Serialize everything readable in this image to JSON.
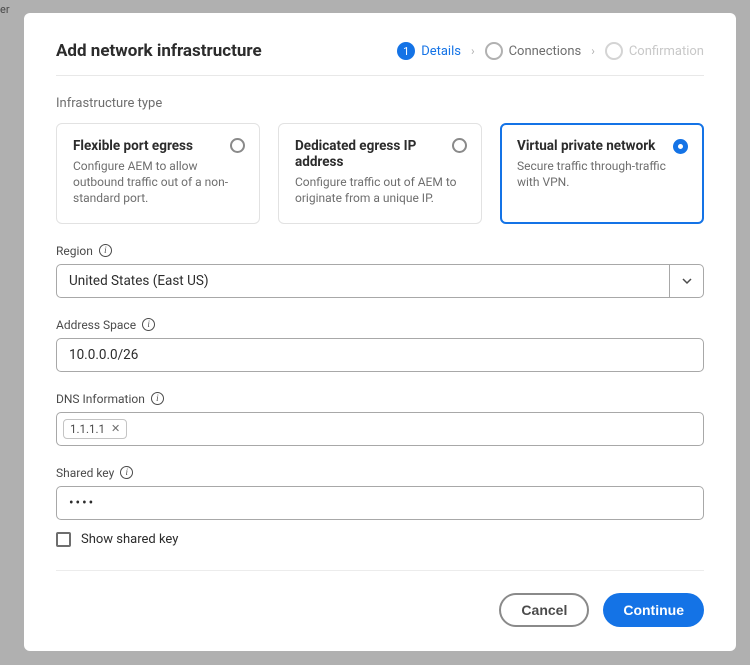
{
  "bg_fragment": "er",
  "header": {
    "title": "Add network infrastructure",
    "steps": [
      {
        "num": "1",
        "label": "Details",
        "state": "active"
      },
      {
        "num": "2",
        "label": "Connections",
        "state": "idle"
      },
      {
        "num": "3",
        "label": "Confirmation",
        "state": "disabled"
      }
    ]
  },
  "infra": {
    "section_label": "Infrastructure type",
    "options": [
      {
        "title": "Flexible port egress",
        "desc": "Configure AEM to allow outbound traffic out of a non-standard port.",
        "selected": false
      },
      {
        "title": "Dedicated egress IP address",
        "desc": "Configure traffic out of AEM to originate from a unique IP.",
        "selected": false
      },
      {
        "title": "Virtual private network",
        "desc": "Secure traffic through-traffic with VPN.",
        "selected": true
      }
    ]
  },
  "fields": {
    "region": {
      "label": "Region",
      "value": "United States (East US)"
    },
    "address_space": {
      "label": "Address Space",
      "value": "10.0.0.0/26"
    },
    "dns": {
      "label": "DNS Information",
      "tags": [
        "1.1.1.1"
      ]
    },
    "shared_key": {
      "label": "Shared key",
      "value": "••••",
      "checkbox_label": "Show shared key",
      "checked": false
    }
  },
  "footer": {
    "cancel": "Cancel",
    "continue": "Continue"
  }
}
